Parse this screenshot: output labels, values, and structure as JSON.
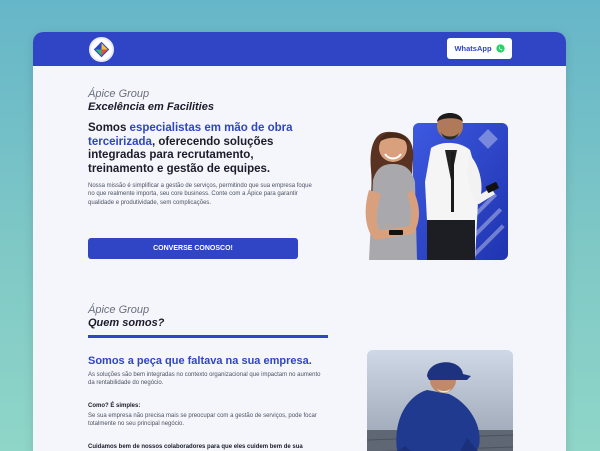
{
  "header": {
    "whatsapp_label": "WhatsApp",
    "logo_text": "Ápice Group"
  },
  "hero": {
    "kicker": "Ápice Group",
    "subtitle": "Excelência em Facilities",
    "headline_before": "Somos ",
    "headline_highlight": "especialistas em mão de obra terceirizada",
    "headline_after": ", oferecendo soluções integradas para recrutamento, treinamento e gestão de equipes.",
    "description": "Nossa missão é simplificar a gestão de serviços, permitindo que sua empresa foque no que realmente importa, seu core business. Conte com a Ápice para garantir qualidade e produtividade, sem complicações.",
    "cta_label": "CONVERSE CONOSCO!"
  },
  "about": {
    "kicker": "Ápice Group",
    "title": "Quem somos?",
    "headline": "Somos a peça que faltava na sua empresa.",
    "paragraph1": "As soluções são bem integradas no contexto organizacional que impactam no aumento da rentabilidade do negócio.",
    "how_title": "Como? É simples:",
    "paragraph2": "Se sua empresa não precisa mais se preocupar com a gestão de serviços, pode focar totalmente no seu principal negócio.",
    "paragraph3": "Cuidamos bem de nossos colaboradores para que eles cuidem bem de sua"
  },
  "colors": {
    "brand_blue": "#2f45c6",
    "background_gradient_top": "#66b6c9",
    "background_gradient_bottom": "#8fd6c8",
    "page_bg": "#f4f6fb",
    "whatsapp_green": "#25d366"
  },
  "icons": {
    "whatsapp": "whatsapp-icon",
    "logo": "apice-logo"
  }
}
